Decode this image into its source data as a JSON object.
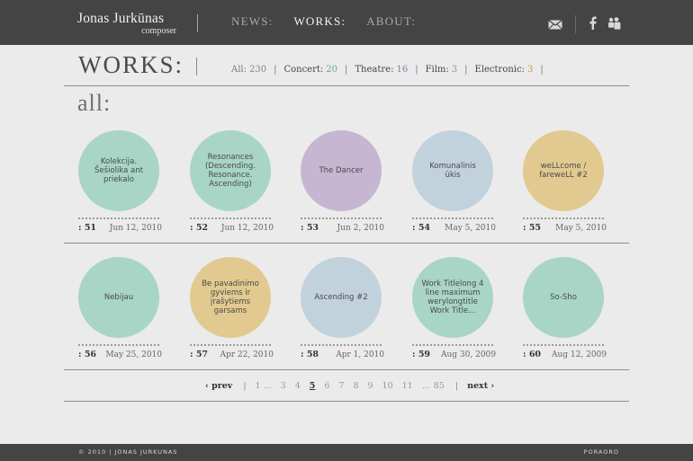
{
  "header": {
    "brand_name": "Jonas Jurkūnas",
    "brand_sub": "composer",
    "nav": [
      {
        "label": "NEWS:",
        "active": false
      },
      {
        "label": "WORKS:",
        "active": true
      },
      {
        "label": "ABOUT:",
        "active": false
      }
    ],
    "icons": [
      "mail-icon",
      "facebook-icon",
      "myspace-icon"
    ]
  },
  "works_bar": {
    "title": "WORKS:",
    "filters": [
      {
        "label": "All:",
        "count": "230",
        "color": "#888888"
      },
      {
        "label": "Concert:",
        "count": "20",
        "color": "#6fa79a"
      },
      {
        "label": "Theatre:",
        "count": "16",
        "color": "#8f7aa8"
      },
      {
        "label": "Film:",
        "count": "3",
        "color": "#7f9bab"
      },
      {
        "label": "Electronic:",
        "count": "3",
        "color": "#c79a3c"
      }
    ]
  },
  "section_title": "all:",
  "works": [
    {
      "title": "Kolekcija. Šešiolika ant priekalo",
      "num": ": 51",
      "date": "Jun 12, 2010",
      "color": "#a8d5c6"
    },
    {
      "title": "Resonances (Descending. Resonance. Ascending)",
      "num": ": 52",
      "date": "Jun 12, 2010",
      "color": "#a8d5c6"
    },
    {
      "title": "The Dancer",
      "num": ": 53",
      "date": "Jun 2, 2010",
      "color": "#c6b6d2"
    },
    {
      "title": "Komunalinis ūkis",
      "num": ": 54",
      "date": "May 5, 2010",
      "color": "#c1d2dc"
    },
    {
      "title": "weLLcome / fareweLL #2",
      "num": ": 55",
      "date": "May 5, 2010",
      "color": "#e2c98f"
    },
    {
      "title": "Nebijau",
      "num": ": 56",
      "date": "May 25, 2010",
      "color": "#a8d5c6"
    },
    {
      "title": "Be pavadinimo gyviems ir įrašytiems garsams",
      "num": ": 57",
      "date": "Apr 22, 2010",
      "color": "#e2c98f"
    },
    {
      "title": "Ascending #2",
      "num": ": 58",
      "date": "Apr 1, 2010",
      "color": "#c1d2dc"
    },
    {
      "title": "Work Titlelong 4 line maximum werylongtitle Work Title...",
      "num": ": 59",
      "date": "Aug 30, 2009",
      "color": "#a8d5c6"
    },
    {
      "title": "So-Sho",
      "num": ": 60",
      "date": "Aug 12, 2009",
      "color": "#a8d5c6"
    }
  ],
  "pager": {
    "prev": "‹ prev",
    "next": "next ›",
    "pages": [
      "1",
      "...",
      "3",
      "4",
      "5",
      "6",
      "7",
      "8",
      "9",
      "10",
      "11",
      "...",
      "85"
    ],
    "current": "5"
  },
  "footer": {
    "copyright": "© 2010 | JONAS JURKUNAS",
    "credit": "PORAORO"
  }
}
